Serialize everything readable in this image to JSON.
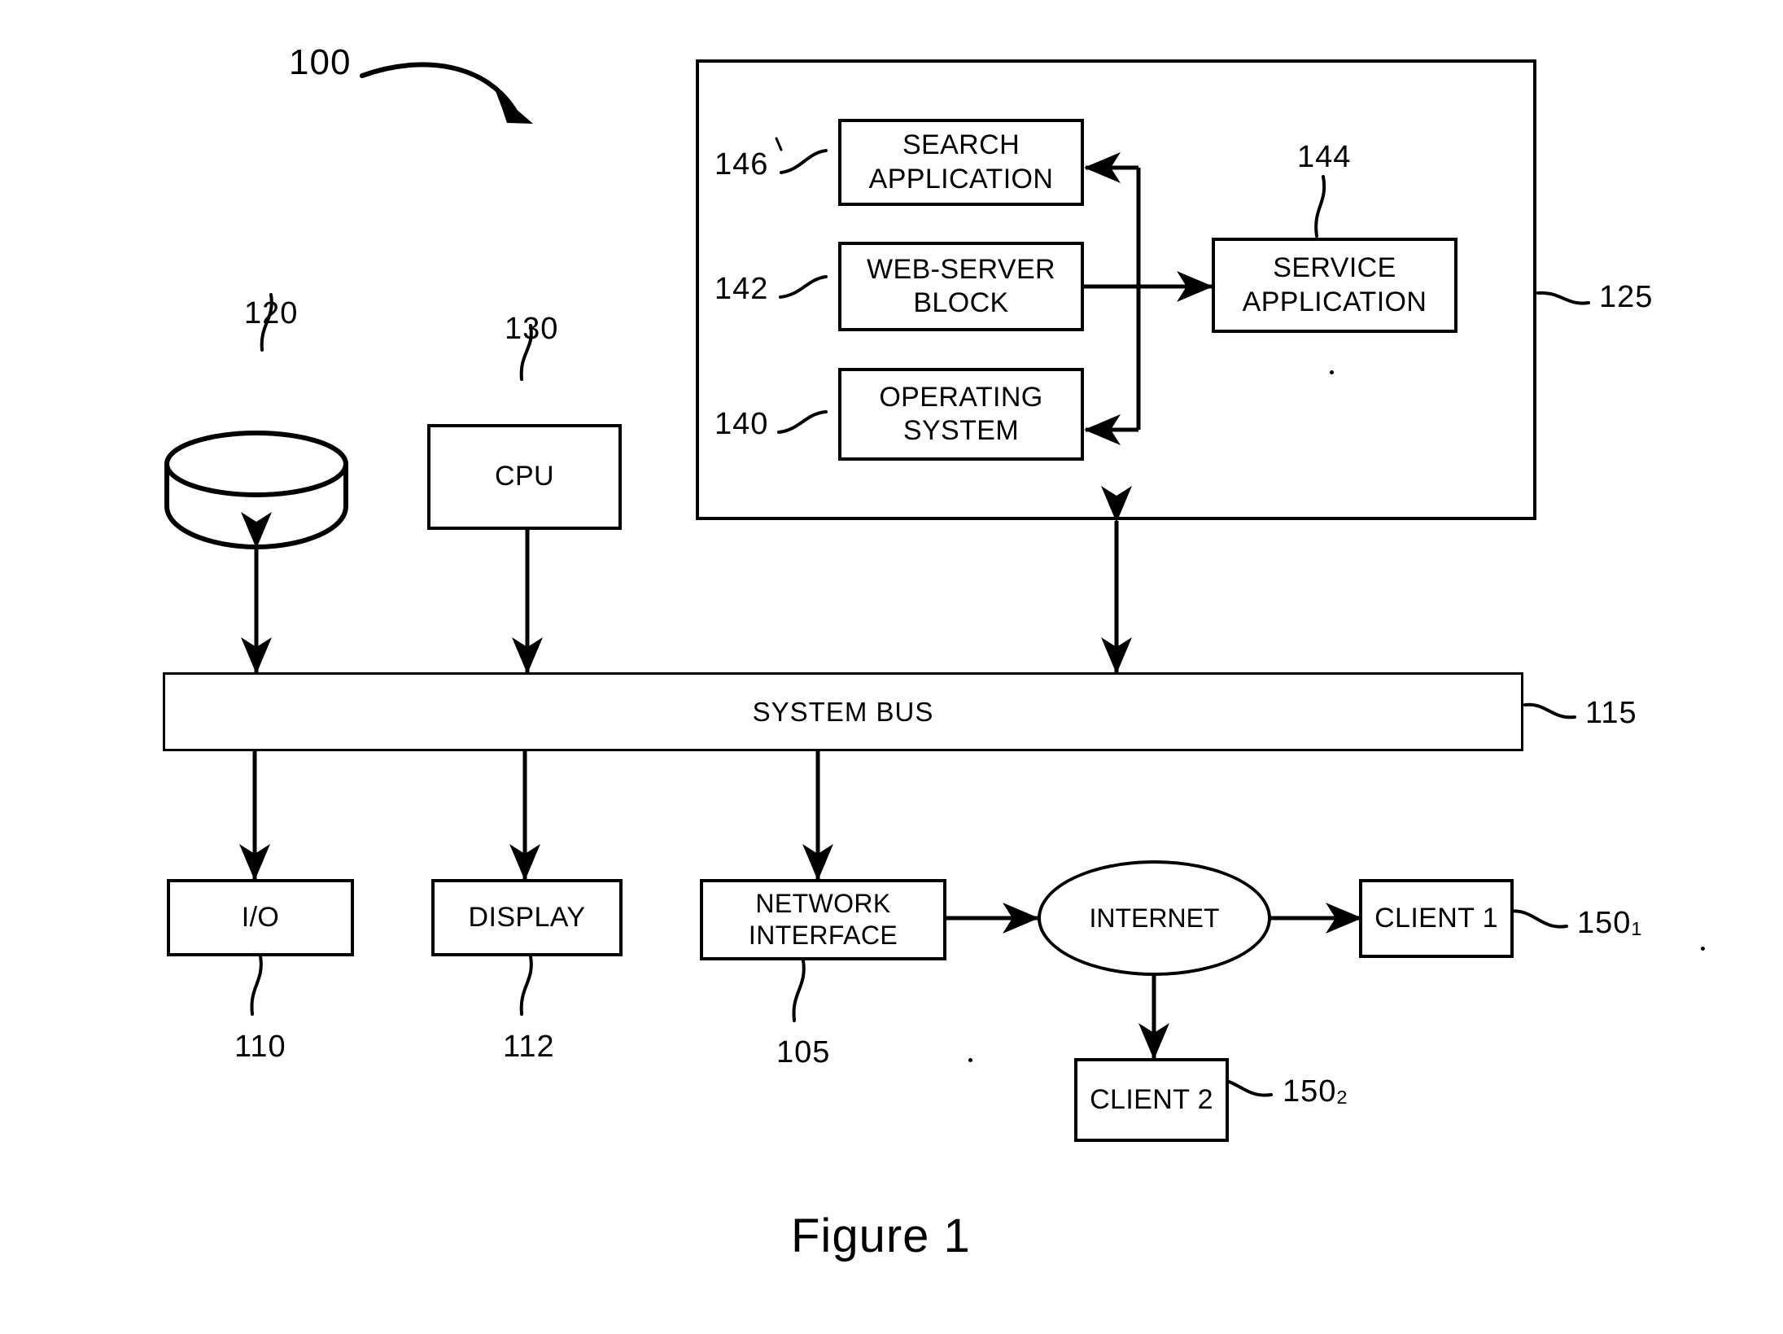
{
  "figure": {
    "caption": "Figure 1",
    "system_ref": "100"
  },
  "memory": {
    "ref": "125",
    "blocks": [
      {
        "id": "search-application",
        "label": "SEARCH\nAPPLICATION",
        "ref": "146"
      },
      {
        "id": "web-server-block",
        "label": "WEB-SERVER\nBLOCK",
        "ref": "142"
      },
      {
        "id": "operating-system",
        "label": "OPERATING\nSYSTEM",
        "ref": "140"
      },
      {
        "id": "service-application",
        "label": "SERVICE\nAPPLICATION",
        "ref": "144"
      }
    ]
  },
  "hardware": {
    "storage": {
      "label": "",
      "ref": "120"
    },
    "cpu": {
      "label": "CPU",
      "ref": "130"
    },
    "bus": {
      "label": "SYSTEM BUS",
      "ref": "115"
    },
    "io": {
      "label": "I/O",
      "ref": "110"
    },
    "display": {
      "label": "DISPLAY",
      "ref": "112"
    },
    "network_interface": {
      "label": "NETWORK\nINTERFACE",
      "ref": "105"
    }
  },
  "network": {
    "internet": {
      "label": "INTERNET"
    },
    "clients": [
      {
        "label": "CLIENT 1",
        "ref": "150",
        "ref_sub": "1"
      },
      {
        "label": "CLIENT 2",
        "ref": "150",
        "ref_sub": "2"
      }
    ]
  },
  "colors": {
    "ink": "#000000",
    "paper": "#ffffff"
  }
}
